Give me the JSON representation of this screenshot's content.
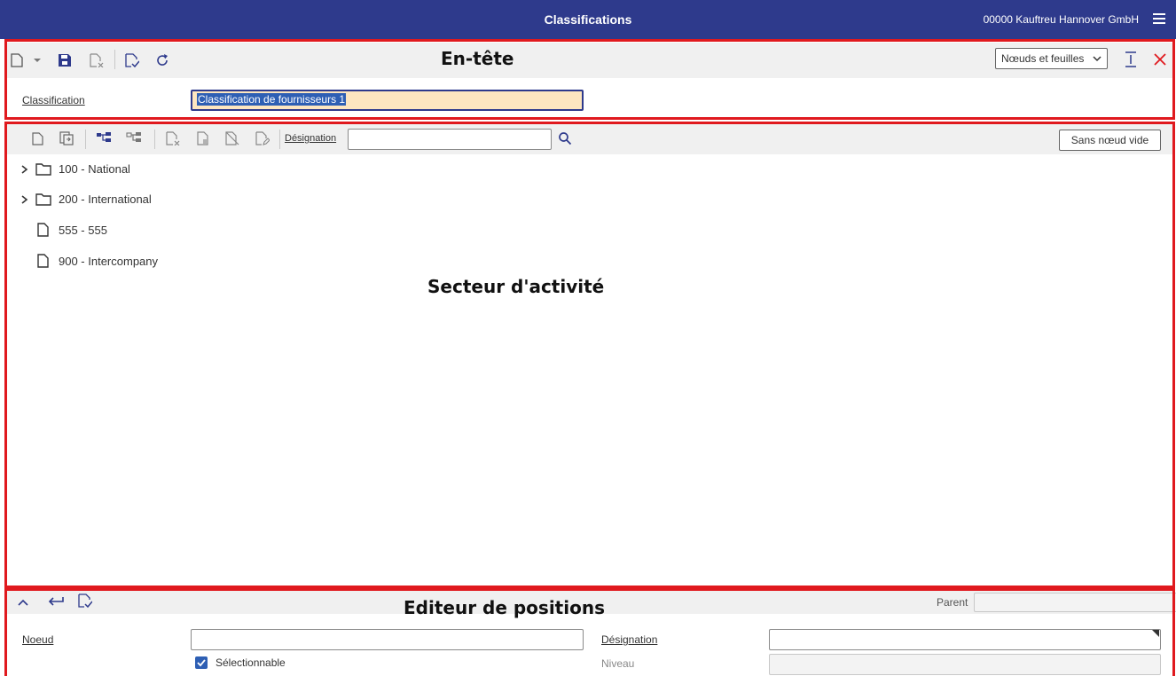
{
  "app": {
    "title": "Classifications",
    "company": "00000 Kauftreu Hannover GmbH"
  },
  "annotations": {
    "header": "En-tête",
    "tree": "Secteur d'activité",
    "editor": "Editeur de positions"
  },
  "header": {
    "view_select": "Nœuds et feuilles",
    "classification_label": "Classification",
    "classification_value": "Classification de fournisseurs 1"
  },
  "tree_toolbar": {
    "designation_label": "Désignation",
    "designation_value": "",
    "empty_node_button": "Sans nœud vide"
  },
  "tree": {
    "items": [
      {
        "label": "100 - National",
        "type": "folder"
      },
      {
        "label": "200 - International",
        "type": "folder"
      },
      {
        "label": "555 - 555",
        "type": "leaf"
      },
      {
        "label": "900 - Intercompany",
        "type": "leaf"
      }
    ]
  },
  "editor": {
    "parent_label": "Parent",
    "parent_value": "",
    "node_label": "Noeud",
    "node_value": "",
    "designation_label": "Désignation",
    "designation_value": "",
    "selectable_label": "Sélectionnable",
    "selectable_checked": true,
    "level_label": "Niveau",
    "level_value": ""
  },
  "colors": {
    "titlebar": "#2e3a8c",
    "accent": "#2e3a8c",
    "annotation": "#e0191e",
    "close": "#e0191e"
  }
}
